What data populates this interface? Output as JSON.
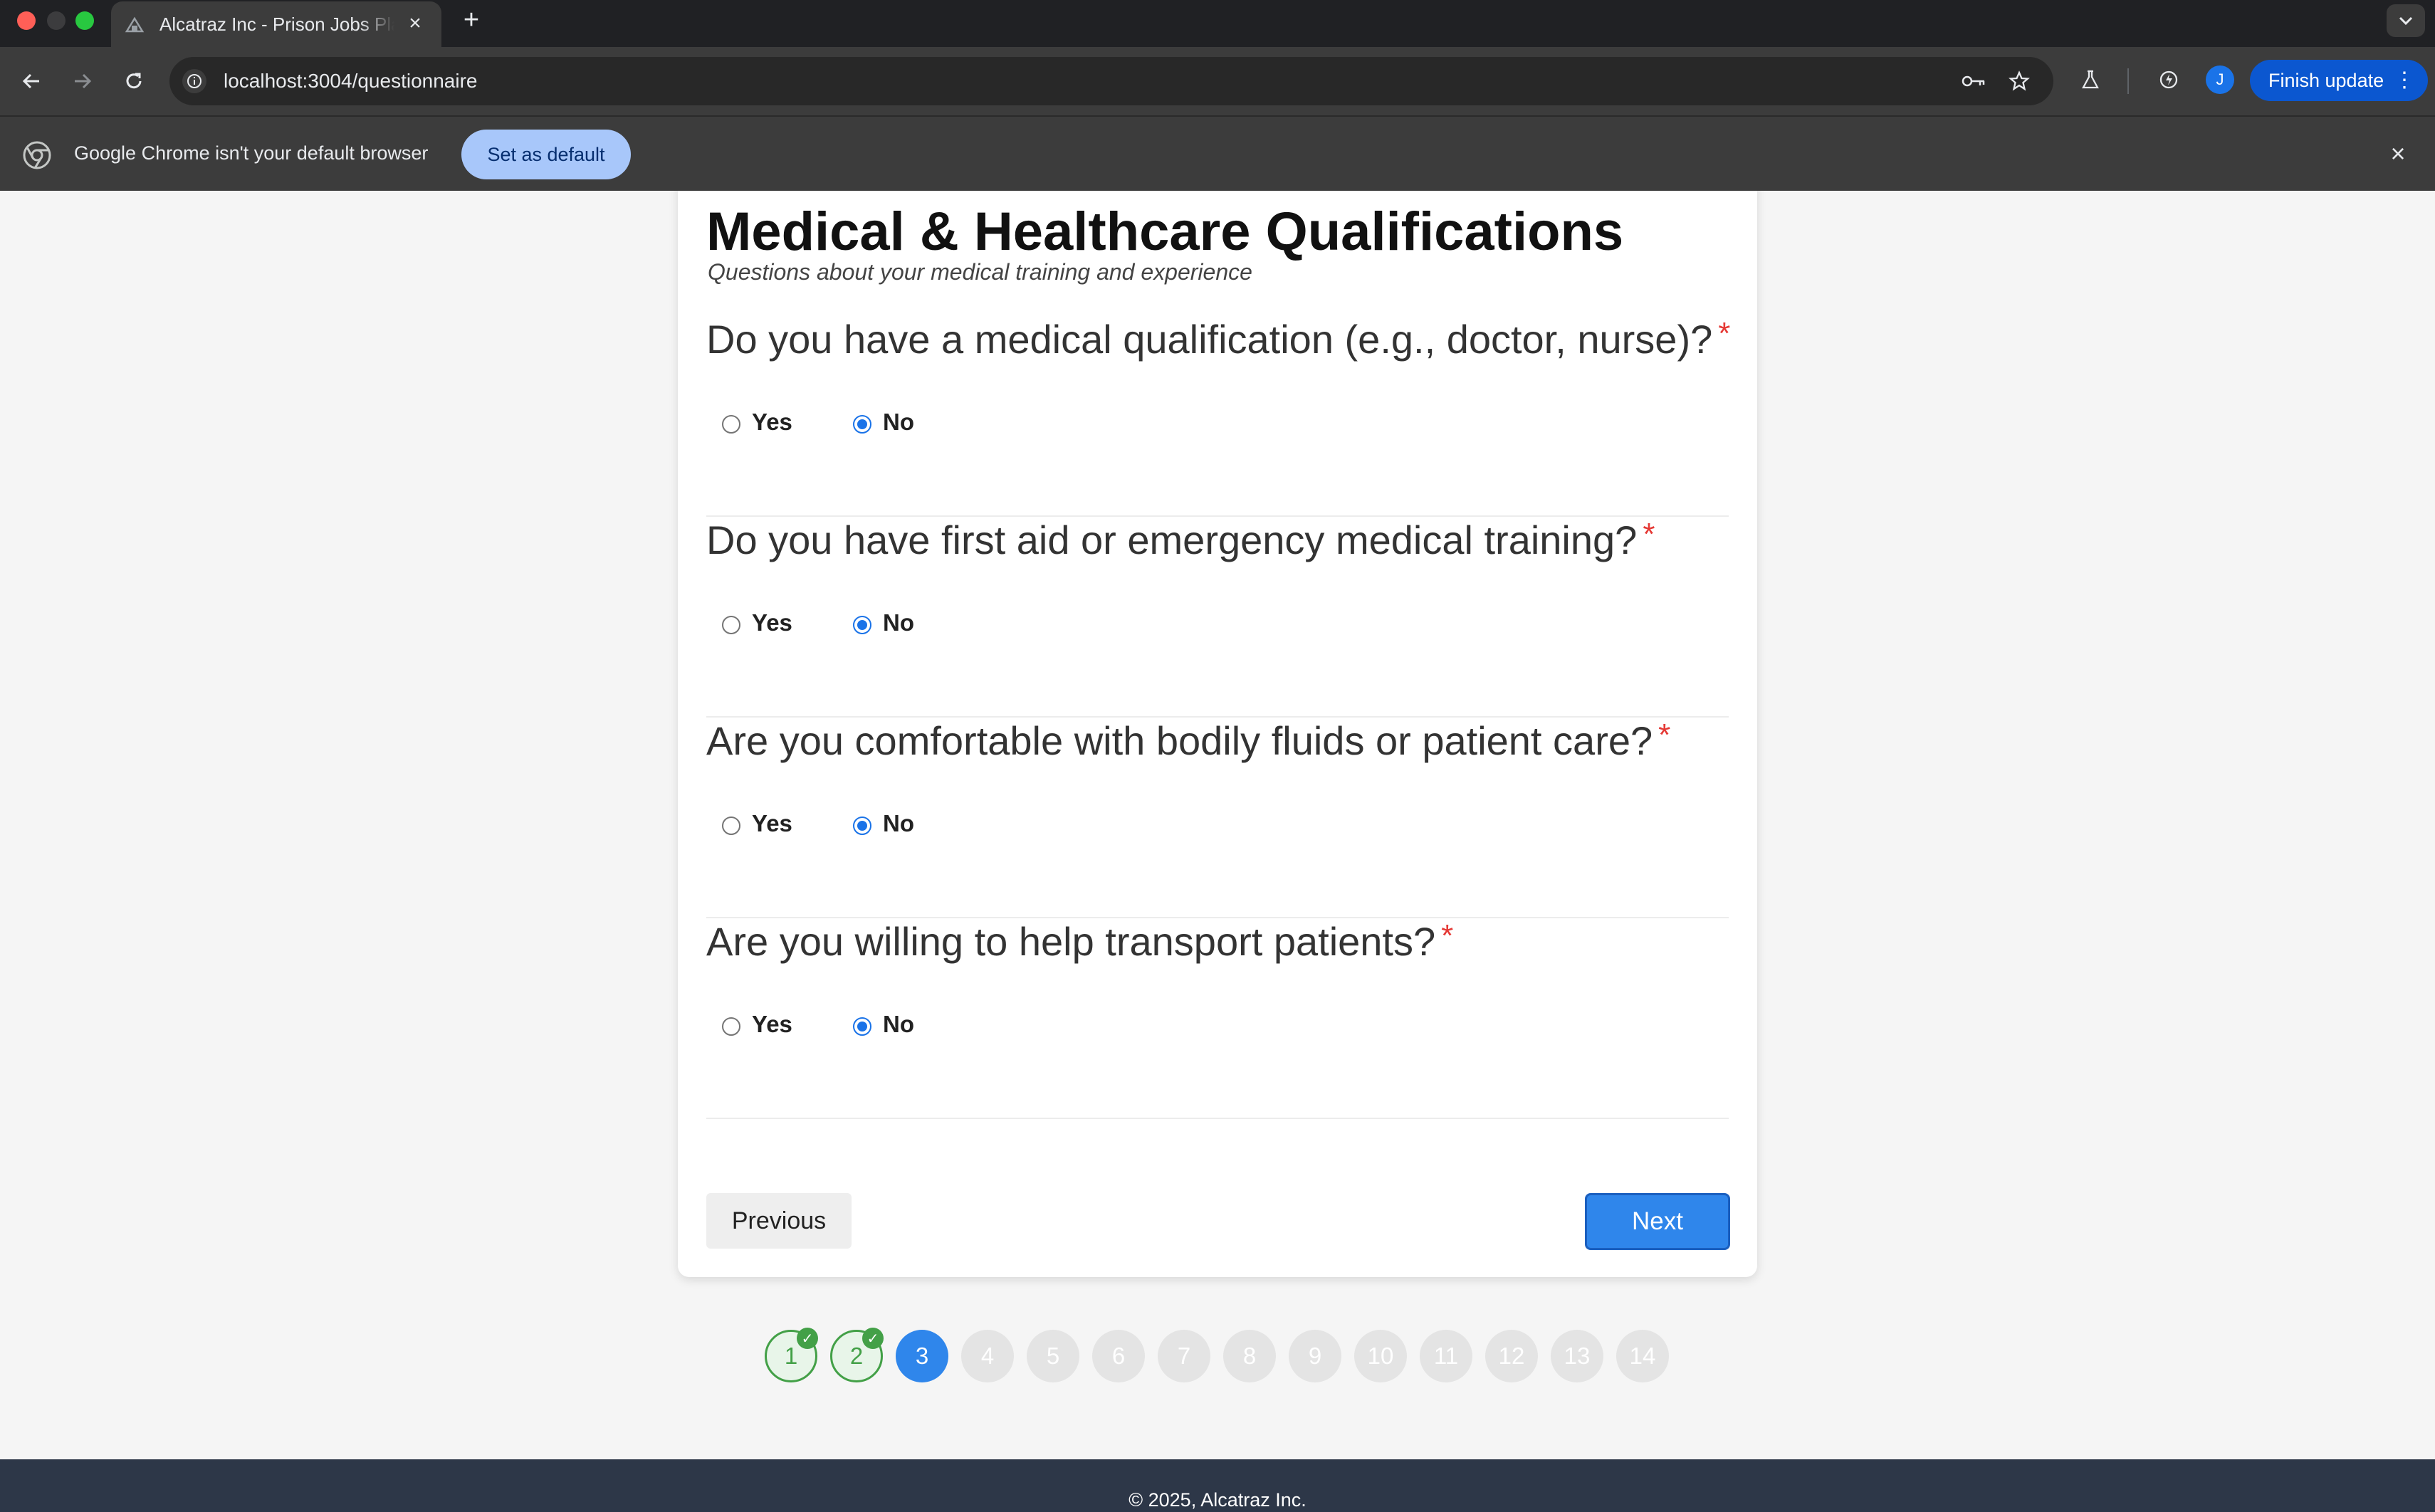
{
  "browser": {
    "tab_title": "Alcatraz Inc - Prison Jobs Platform",
    "url": "localhost:3004/questionnaire",
    "avatar_initial": "J",
    "finish_update_label": "Finish update"
  },
  "infobar": {
    "message": "Google Chrome isn't your default browser",
    "set_default_label": "Set as default"
  },
  "section": {
    "title": "Medical & Healthcare Qualifications",
    "subtitle": "Questions about your medical training and experience"
  },
  "questions": [
    {
      "text": "Do you have a medical qualification (e.g., doctor, nurse)?",
      "required_mark": "*",
      "options": [
        "Yes",
        "No"
      ],
      "selected": "No"
    },
    {
      "text": "Do you have first aid or emergency medical training?",
      "required_mark": "*",
      "options": [
        "Yes",
        "No"
      ],
      "selected": "No"
    },
    {
      "text": "Are you comfortable with bodily fluids or patient care?",
      "required_mark": "*",
      "options": [
        "Yes",
        "No"
      ],
      "selected": "No"
    },
    {
      "text": "Are you willing to help transport patients?",
      "required_mark": "*",
      "options": [
        "Yes",
        "No"
      ],
      "selected": "No"
    }
  ],
  "nav": {
    "previous_label": "Previous",
    "next_label": "Next"
  },
  "steps": {
    "labels": [
      "1",
      "2",
      "3",
      "4",
      "5",
      "6",
      "7",
      "8",
      "9",
      "10",
      "11",
      "12",
      "13",
      "14"
    ],
    "completed": [
      "1",
      "2"
    ],
    "current": "3",
    "check_mark": "✓"
  },
  "footer": {
    "text": "© 2025, Alcatraz Inc."
  }
}
